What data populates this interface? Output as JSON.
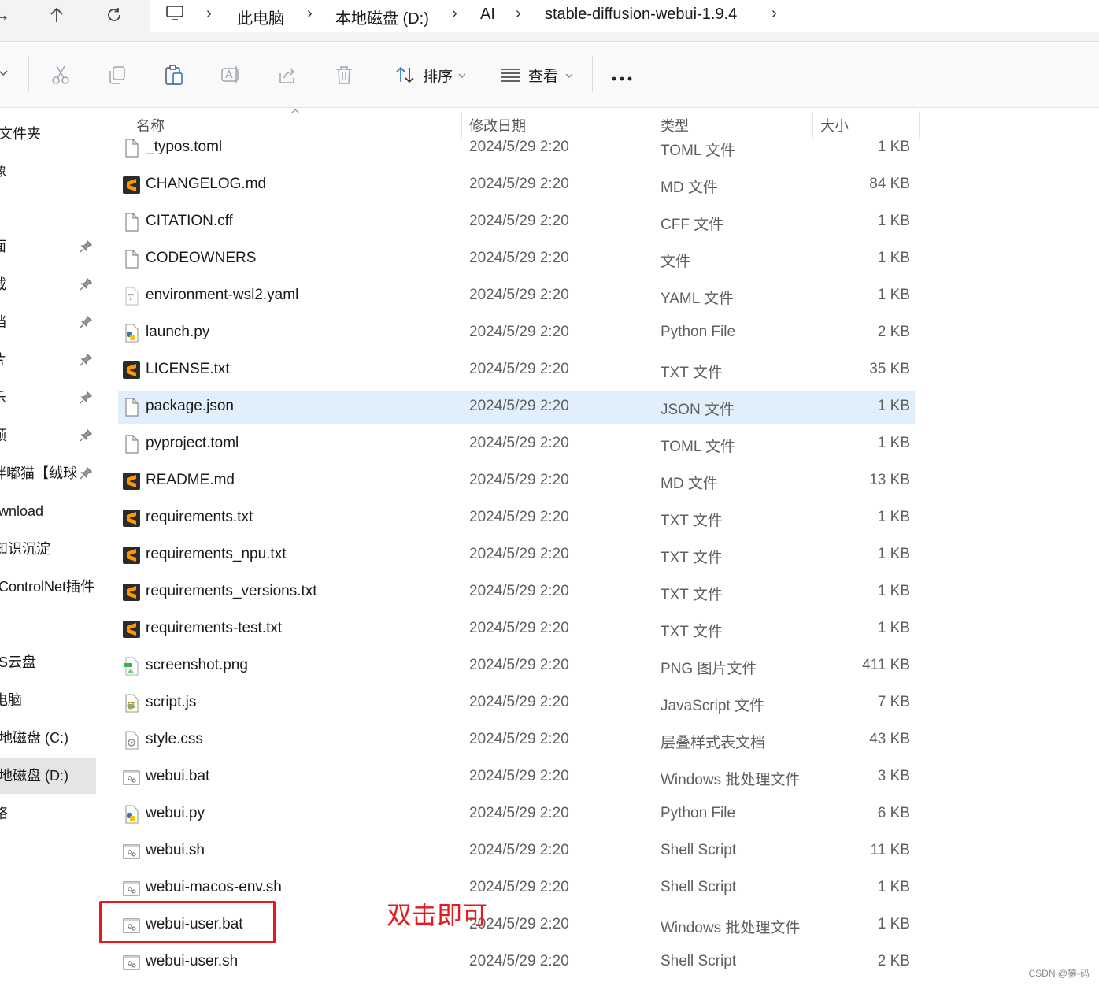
{
  "address_bar": {
    "crumbs": [
      "此电脑",
      "本地磁盘 (D:)",
      "AI",
      "stable-diffusion-webui-1.9.4"
    ]
  },
  "toolbar": {
    "sort_label": "排序",
    "view_label": "查看"
  },
  "sidebar": {
    "items": [
      "文件夹",
      "像",
      "面",
      "载",
      "档",
      "片",
      "乐",
      "频",
      "胖嘟猫【绒球",
      "wnload",
      "知识沉淀",
      "ControlNet插件",
      "S云盘",
      "电脑",
      "地磁盘 (C:)",
      "地磁盘 (D:)",
      "络"
    ]
  },
  "columns": {
    "name": "名称",
    "date": "修改日期",
    "type": "类型",
    "size": "大小"
  },
  "files": [
    {
      "name": "_typos.toml",
      "date": "2024/5/29 2:20",
      "type": "TOML 文件",
      "size": "1 KB",
      "icon": "file-icon"
    },
    {
      "name": "CHANGELOG.md",
      "date": "2024/5/29 2:20",
      "type": "MD 文件",
      "size": "84 KB",
      "icon": "sublime-icon"
    },
    {
      "name": "CITATION.cff",
      "date": "2024/5/29 2:20",
      "type": "CFF 文件",
      "size": "1 KB",
      "icon": "file-icon"
    },
    {
      "name": "CODEOWNERS",
      "date": "2024/5/29 2:20",
      "type": "文件",
      "size": "1 KB",
      "icon": "file-icon"
    },
    {
      "name": "environment-wsl2.yaml",
      "date": "2024/5/29 2:20",
      "type": "YAML 文件",
      "size": "1 KB",
      "icon": "text-file-icon"
    },
    {
      "name": "launch.py",
      "date": "2024/5/29 2:20",
      "type": "Python File",
      "size": "2 KB",
      "icon": "python-icon"
    },
    {
      "name": "LICENSE.txt",
      "date": "2024/5/29 2:20",
      "type": "TXT 文件",
      "size": "35 KB",
      "icon": "sublime-icon"
    },
    {
      "name": "package.json",
      "date": "2024/5/29 2:20",
      "type": "JSON 文件",
      "size": "1 KB",
      "icon": "file-icon"
    },
    {
      "name": "pyproject.toml",
      "date": "2024/5/29 2:20",
      "type": "TOML 文件",
      "size": "1 KB",
      "icon": "file-icon"
    },
    {
      "name": "README.md",
      "date": "2024/5/29 2:20",
      "type": "MD 文件",
      "size": "13 KB",
      "icon": "sublime-icon"
    },
    {
      "name": "requirements.txt",
      "date": "2024/5/29 2:20",
      "type": "TXT 文件",
      "size": "1 KB",
      "icon": "sublime-icon"
    },
    {
      "name": "requirements_npu.txt",
      "date": "2024/5/29 2:20",
      "type": "TXT 文件",
      "size": "1 KB",
      "icon": "sublime-icon"
    },
    {
      "name": "requirements_versions.txt",
      "date": "2024/5/29 2:20",
      "type": "TXT 文件",
      "size": "1 KB",
      "icon": "sublime-icon"
    },
    {
      "name": "requirements-test.txt",
      "date": "2024/5/29 2:20",
      "type": "TXT 文件",
      "size": "1 KB",
      "icon": "sublime-icon"
    },
    {
      "name": "screenshot.png",
      "date": "2024/5/29 2:20",
      "type": "PNG 图片文件",
      "size": "411 KB",
      "icon": "image-icon"
    },
    {
      "name": "script.js",
      "date": "2024/5/29 2:20",
      "type": "JavaScript 文件",
      "size": "7 KB",
      "icon": "script-icon"
    },
    {
      "name": "style.css",
      "date": "2024/5/29 2:20",
      "type": "层叠样式表文档",
      "size": "43 KB",
      "icon": "css-icon"
    },
    {
      "name": "webui.bat",
      "date": "2024/5/29 2:20",
      "type": "Windows 批处理文件",
      "size": "3 KB",
      "icon": "batch-icon"
    },
    {
      "name": "webui.py",
      "date": "2024/5/29 2:20",
      "type": "Python File",
      "size": "6 KB",
      "icon": "python-icon"
    },
    {
      "name": "webui.sh",
      "date": "2024/5/29 2:20",
      "type": "Shell Script",
      "size": "11 KB",
      "icon": "batch-icon"
    },
    {
      "name": "webui-macos-env.sh",
      "date": "2024/5/29 2:20",
      "type": "Shell Script",
      "size": "1 KB",
      "icon": "batch-icon"
    },
    {
      "name": "webui-user.bat",
      "date": "2024/5/29 2:20",
      "type": "Windows 批处理文件",
      "size": "1 KB",
      "icon": "batch-icon"
    },
    {
      "name": "webui-user.sh",
      "date": "2024/5/29 2:20",
      "type": "Shell Script",
      "size": "2 KB",
      "icon": "batch-icon"
    }
  ],
  "selected_file": "package.json",
  "annotation": {
    "text": "双击即可",
    "target": "webui-user.bat",
    "color": "#e8191d"
  },
  "watermark": "CSDN @猿-码"
}
